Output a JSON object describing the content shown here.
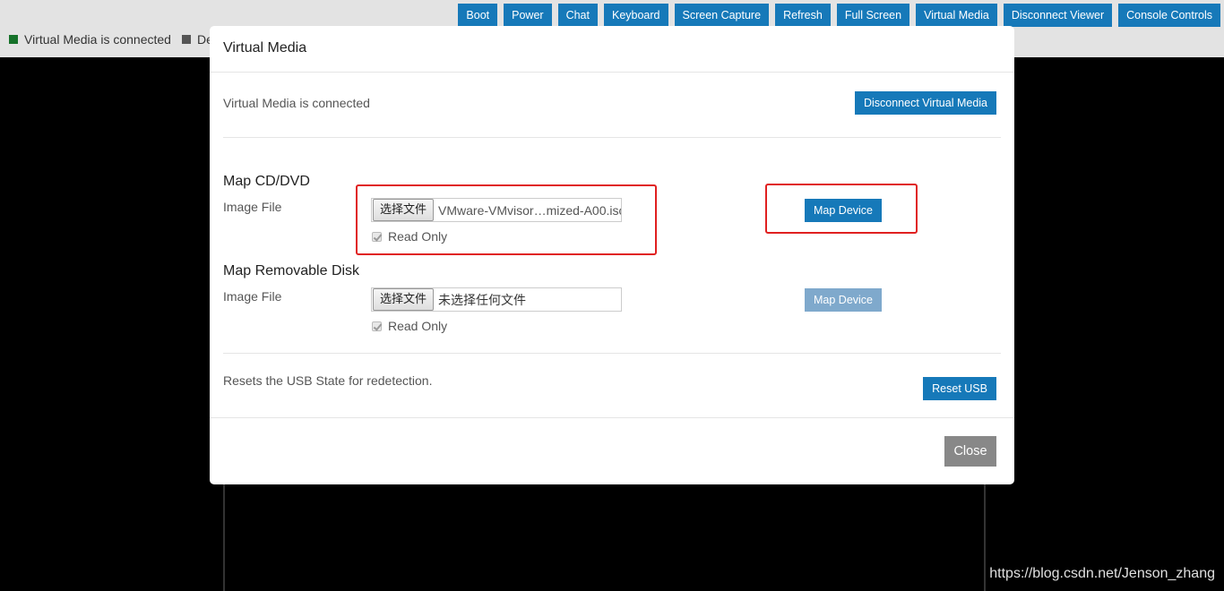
{
  "toolbar": {
    "buttons": [
      "Boot",
      "Power",
      "Chat",
      "Keyboard",
      "Screen Capture",
      "Refresh",
      "Full Screen",
      "Virtual Media",
      "Disconnect Viewer",
      "Console Controls"
    ]
  },
  "status": {
    "virtual_media": "Virtual Media is connected",
    "other": "De"
  },
  "colors": {
    "accent": "#1679b9",
    "status_green": "#16722a",
    "highlight_red": "#e02020"
  },
  "modal": {
    "title": "Virtual Media",
    "connection_status": "Virtual Media is connected",
    "disconnect_label": "Disconnect Virtual Media",
    "cd_dvd": {
      "title": "Map CD/DVD",
      "image_label": "Image File",
      "choose_label": "选择文件",
      "file_name": "VMware-VMvisor…mized-A00.iso",
      "read_only_label": "Read Only",
      "map_label": "Map Device"
    },
    "removable": {
      "title": "Map Removable Disk",
      "image_label": "Image File",
      "choose_label": "选择文件",
      "file_name": "未选择任何文件",
      "read_only_label": "Read Only",
      "map_label": "Map Device"
    },
    "usb": {
      "description": "Resets the USB State for redetection.",
      "reset_label": "Reset USB"
    },
    "close_label": "Close"
  },
  "watermark": "https://blog.csdn.net/Jenson_zhang"
}
